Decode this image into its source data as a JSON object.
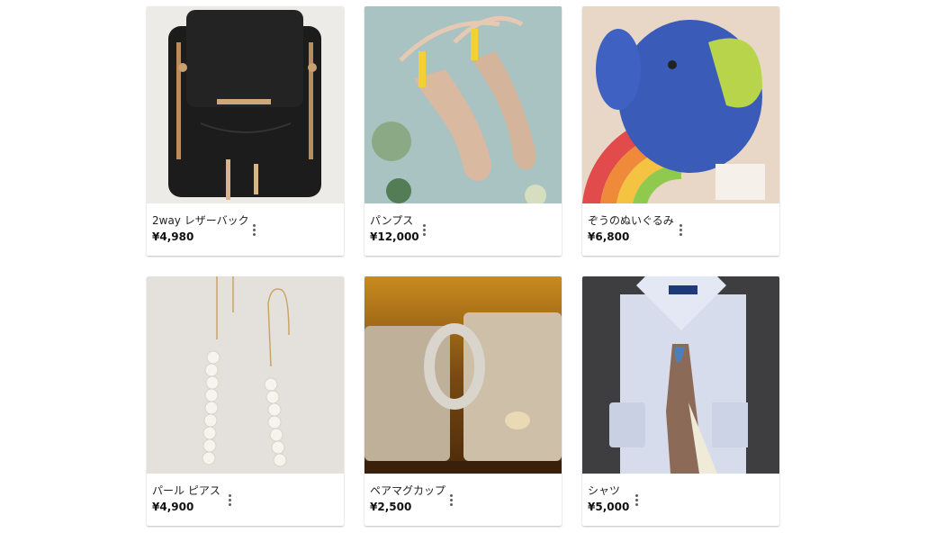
{
  "products": [
    {
      "name": "2way レザーバック",
      "price": "¥4,980",
      "icon": "backpack"
    },
    {
      "name": "パンプス",
      "price": "¥12,000",
      "icon": "pumps"
    },
    {
      "name": "ぞうのぬいぐるみ",
      "price": "¥6,800",
      "icon": "elephant-plush"
    },
    {
      "name": "パール ピアス",
      "price": "¥4,900",
      "icon": "pearl-earrings"
    },
    {
      "name": "ペアマグカップ",
      "price": "¥2,500",
      "icon": "mug-pair"
    },
    {
      "name": "シャツ",
      "price": "¥5,000",
      "icon": "shirt"
    }
  ],
  "menu_icon": "more-vert-icon"
}
